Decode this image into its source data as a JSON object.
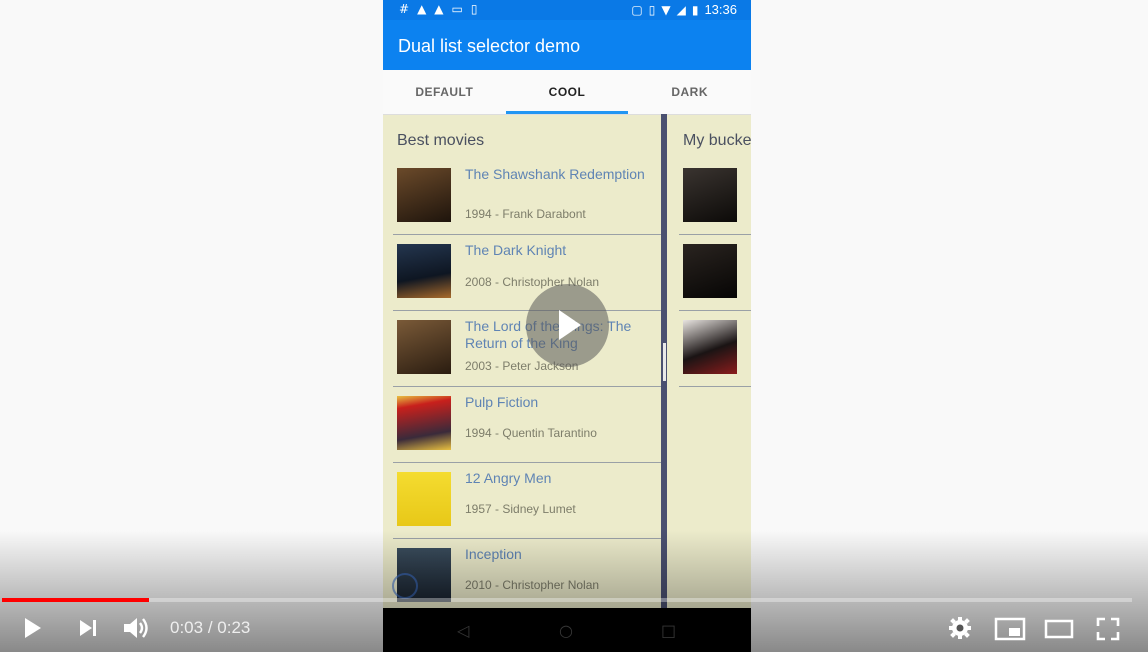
{
  "statusbar": {
    "time": "13:36"
  },
  "app": {
    "title": "Dual list selector demo"
  },
  "tabs": [
    {
      "label": "DEFAULT"
    },
    {
      "label": "COOL"
    },
    {
      "label": "DARK"
    }
  ],
  "left_list": {
    "title": "Best movies",
    "items": [
      {
        "title": "The Shawshank Redemption",
        "subtitle": "1994 - Frank Darabont",
        "poster_color": "#3a2a1a"
      },
      {
        "title": "The Dark Knight",
        "subtitle": "2008 - Christopher Nolan",
        "poster_color": "#1c2a44"
      },
      {
        "title": "The Lord of the Rings: The Return of the King",
        "subtitle": "2003 - Peter Jackson",
        "poster_color": "#5a4028"
      },
      {
        "title": "Pulp Fiction",
        "subtitle": "1994 - Quentin Tarantino",
        "poster_color": "#c8201c"
      },
      {
        "title": "12 Angry Men",
        "subtitle": "1957 - Sidney Lumet",
        "poster_color": "#f2d020"
      },
      {
        "title": "Inception",
        "subtitle": "2010 - Christopher Nolan",
        "poster_color": "#2a3a4a"
      }
    ]
  },
  "right_list": {
    "title": "My bucket list",
    "items": [
      {
        "poster_color": "#201c18"
      },
      {
        "poster_color": "#141210"
      },
      {
        "poster_color": "#3a2a26"
      }
    ]
  },
  "player": {
    "current_time": "0:03",
    "duration": "0:23",
    "progress": 0.13
  }
}
